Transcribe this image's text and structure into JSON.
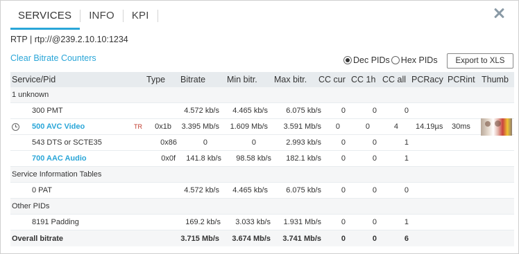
{
  "tabs": [
    {
      "label": "SERVICES"
    },
    {
      "label": "INFO"
    },
    {
      "label": "KPI"
    }
  ],
  "source": "RTP | rtp://@239.2.10.10:1234",
  "clear_link": "Clear Bitrate Counters",
  "pid_mode": {
    "dec_label": "Dec PIDs",
    "hex_label": "Hex PIDs",
    "selected": "dec"
  },
  "export_label": "Export to XLS",
  "columns": {
    "service": "Service/Pid",
    "type": "Type",
    "bitrate": "Bitrate",
    "min": "Min bitr.",
    "max": "Max bitr.",
    "cc_cur": "CC cur",
    "cc_1h": "CC 1h",
    "cc_all": "CC all",
    "pcracy": "PCRacy",
    "pcrint": "PCRint",
    "thumb": "Thumb"
  },
  "rows": {
    "g1": {
      "label": "1 unknown"
    },
    "r1": {
      "name": "300 PMT",
      "badge": "",
      "type": "",
      "bitrate": "4.572 kb/s",
      "min": "4.465 kb/s",
      "max": "6.075 kb/s",
      "cc_cur": "0",
      "cc_1h": "0",
      "cc_all": "0",
      "pcracy": "",
      "pcrint": ""
    },
    "r2": {
      "name": "500 AVC Video",
      "badge": "TR",
      "type": "0x1b",
      "bitrate": "3.395 Mb/s",
      "min": "1.609 Mb/s",
      "max": "3.591 Mb/s",
      "cc_cur": "0",
      "cc_1h": "0",
      "cc_all": "4",
      "pcracy": "14.19µs",
      "pcrint": "30ms",
      "icon": "clock-icon"
    },
    "r3": {
      "name": "543 DTS or SCTE35",
      "badge": "",
      "type": "0x86",
      "bitrate": "0",
      "min": "0",
      "max": "2.993 kb/s",
      "cc_cur": "0",
      "cc_1h": "0",
      "cc_all": "1",
      "pcracy": "",
      "pcrint": ""
    },
    "r4": {
      "name": "700 AAC Audio",
      "badge": "",
      "type": "0x0f",
      "bitrate": "141.8 kb/s",
      "min": "98.58 kb/s",
      "max": "182.1 kb/s",
      "cc_cur": "0",
      "cc_1h": "0",
      "cc_all": "1",
      "pcracy": "",
      "pcrint": ""
    },
    "g2": {
      "label": "Service Information Tables"
    },
    "r5": {
      "name": "0 PAT",
      "badge": "",
      "type": "",
      "bitrate": "4.572 kb/s",
      "min": "4.465 kb/s",
      "max": "6.075 kb/s",
      "cc_cur": "0",
      "cc_1h": "0",
      "cc_all": "0",
      "pcracy": "",
      "pcrint": ""
    },
    "g3": {
      "label": "Other PIDs"
    },
    "r6": {
      "name": "8191 Padding",
      "badge": "",
      "type": "",
      "bitrate": "169.2 kb/s",
      "min": "3.033 kb/s",
      "max": "1.931 Mb/s",
      "cc_cur": "0",
      "cc_1h": "0",
      "cc_all": "1",
      "pcracy": "",
      "pcrint": ""
    },
    "total": {
      "name": "Overall bitrate",
      "bitrate": "3.715 Mb/s",
      "min": "3.674 Mb/s",
      "max": "3.741 Mb/s",
      "cc_cur": "0",
      "cc_1h": "0",
      "cc_all": "6"
    }
  },
  "colors": {
    "accent": "#2aa6d8",
    "header_bg": "#e7ebee",
    "badge": "#c0392b"
  }
}
